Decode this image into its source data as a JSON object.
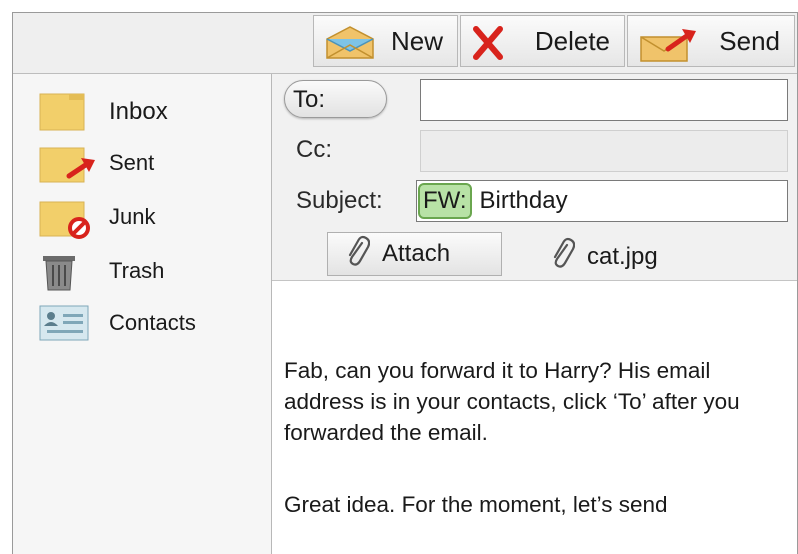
{
  "toolbar": {
    "new_label": "New",
    "delete_label": "Delete",
    "send_label": "Send"
  },
  "sidebar": {
    "items": [
      {
        "label": "Inbox",
        "icon": "folder-icon"
      },
      {
        "label": "Sent",
        "icon": "folder-sent-icon"
      },
      {
        "label": "Junk",
        "icon": "folder-junk-icon"
      },
      {
        "label": "Trash",
        "icon": "trash-icon"
      },
      {
        "label": "Contacts",
        "icon": "contacts-card-icon"
      }
    ]
  },
  "compose": {
    "to_label": "To:",
    "to_value": "",
    "cc_label": "Cc:",
    "cc_value": "",
    "subject_label": "Subject:",
    "subject_prefix": "FW:",
    "subject_text": "Birthday",
    "attach_label": "Attach",
    "attachment_name": "cat.jpg"
  },
  "message": {
    "paragraph_1": "Fab, can you forward it to Harry? His email address is in your contacts, click ‘To’ after you forwarded the email.",
    "paragraph_2": "Great idea. For the moment, let’s send"
  },
  "colors": {
    "fw_highlight": "#b8e2a6",
    "fw_border": "#6aa64f",
    "delete_red": "#d8231c",
    "folder_yellow": "#f2cf6a"
  }
}
